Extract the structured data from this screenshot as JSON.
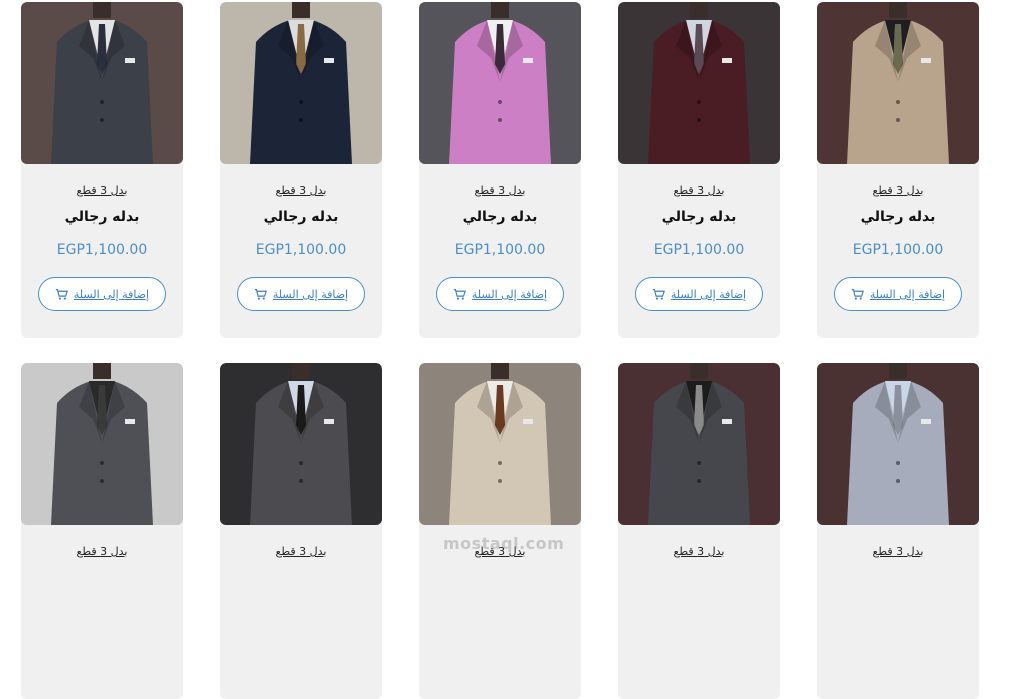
{
  "products": [
    {
      "category": "بدل 3 قطع",
      "title": "بدله رجالي",
      "price": "EGP1,100.00",
      "button": "إضافة إلى السلة",
      "bg": "#5a4a48",
      "suit": "#3c4048",
      "tie": "#2a2f40",
      "shirt": "#e4e4e4"
    },
    {
      "category": "بدل 3 قطع",
      "title": "بدله رجالي",
      "price": "EGP1,100.00",
      "button": "إضافة إلى السلة",
      "bg": "#bdb6aa",
      "suit": "#1c2438",
      "tie": "#8a6a45",
      "shirt": "#dcdcdc"
    },
    {
      "category": "بدل 3 قطع",
      "title": "بدله رجالي",
      "price": "EGP1,100.00",
      "button": "إضافة إلى السلة",
      "bg": "#55545a",
      "suit": "#cc7fc4",
      "tie": "#3a2a3a",
      "shirt": "#f0f0f0"
    },
    {
      "category": "بدل 3 قطع",
      "title": "بدله رجالي",
      "price": "EGP1,100.00",
      "button": "إضافة إلى السلة",
      "bg": "#3a3436",
      "suit": "#4a1c24",
      "tie": "#5a4a55",
      "shirt": "#cfd6e0"
    },
    {
      "category": "بدل 3 قطع",
      "title": "بدله رجالي",
      "price": "EGP1,100.00",
      "button": "إضافة إلى السلة",
      "bg": "#4e3432",
      "suit": "#b8a38c",
      "tie": "#6a6a50",
      "shirt": "#1e1e22"
    },
    {
      "category": "بدل 3 قطع",
      "title": "",
      "price": "",
      "button": "",
      "bg": "#c9c9c9",
      "suit": "#4e5056",
      "tie": "#3a3a3a",
      "shirt": "#2a2a2a"
    },
    {
      "category": "بدل 3 قطع",
      "title": "",
      "price": "",
      "button": "",
      "bg": "#2e2e30",
      "suit": "#4c4c50",
      "tie": "#1a1a1a",
      "shirt": "#cfd8e4"
    },
    {
      "category": "بدل 3 قطع",
      "title": "",
      "price": "",
      "button": "",
      "bg": "#8d857b",
      "suit": "#d2c7b4",
      "tie": "#6a3a22",
      "shirt": "#ecebe8"
    },
    {
      "category": "بدل 3 قطع",
      "title": "",
      "price": "",
      "button": "",
      "bg": "#4a3032",
      "suit": "#46474c",
      "tie": "#8a8a8a",
      "shirt": "#1c1c1c"
    },
    {
      "category": "بدل 3 قطع",
      "title": "",
      "price": "",
      "button": "",
      "bg": "#4a3232",
      "suit": "#a7acbc",
      "tie": "#8c8f9c",
      "shirt": "#c8d6e8"
    }
  ],
  "watermark": "mostaql.com"
}
